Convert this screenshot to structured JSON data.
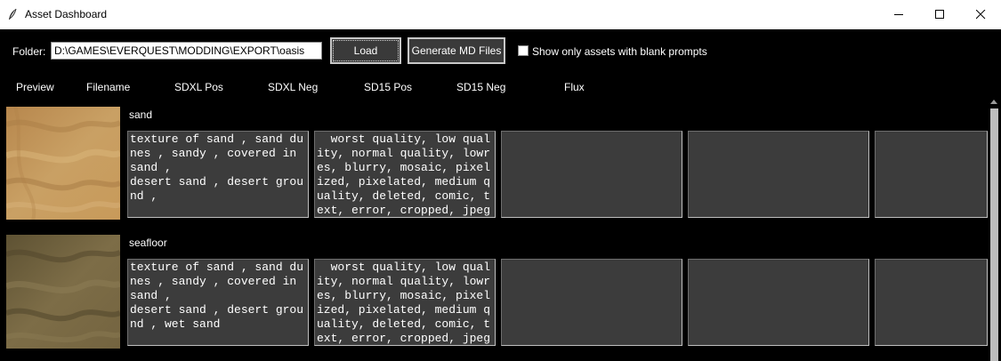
{
  "window": {
    "title": "Asset Dashboard",
    "controls": [
      "minimize-icon",
      "maximize-icon",
      "close-icon"
    ]
  },
  "toolbar": {
    "folder_label": "Folder:",
    "folder_value": "D:\\GAMES\\EVERQUEST\\MODDING\\EXPORT\\oasis",
    "load_label": "Load",
    "generate_label": "Generate MD Files",
    "blank_only_label": "Show only assets with blank prompts",
    "blank_only_checked": false
  },
  "columns": [
    "Preview",
    "Filename",
    "SDXL Pos",
    "SDXL Neg",
    "SD15 Pos",
    "SD15 Neg",
    "Flux"
  ],
  "assets": [
    {
      "filename": "sand",
      "sdxl_pos": "texture of sand , sand du\nnes , sandy , covered in\nsand ,\ndesert sand , desert grou\nnd ,",
      "sdxl_neg": "  worst quality, low qual\nity, normal quality, lowr\nes, blurry, mosaic, pixel\nized, pixelated, medium q\nuality, deleted, comic, t\next, error, cropped, jpeg",
      "sd15_pos": "",
      "sd15_neg": "",
      "flux": ""
    },
    {
      "filename": "seafloor",
      "sdxl_pos": "texture of sand , sand du\nnes , sandy , covered in\nsand ,\ndesert sand , desert grou\nnd , wet sand",
      "sdxl_neg": "  worst quality, low qual\nity, normal quality, lowr\nes, blurry, mosaic, pixel\nized, pixelated, medium q\nuality, deleted, comic, t\next, error, cropped, jpeg",
      "sd15_pos": "",
      "sd15_neg": "",
      "flux": ""
    }
  ],
  "colors": {
    "background": "#000000",
    "cell_background": "#3c3c3c",
    "sand_preview": "#c29a5f",
    "seafloor_preview": "#7a6a45"
  }
}
